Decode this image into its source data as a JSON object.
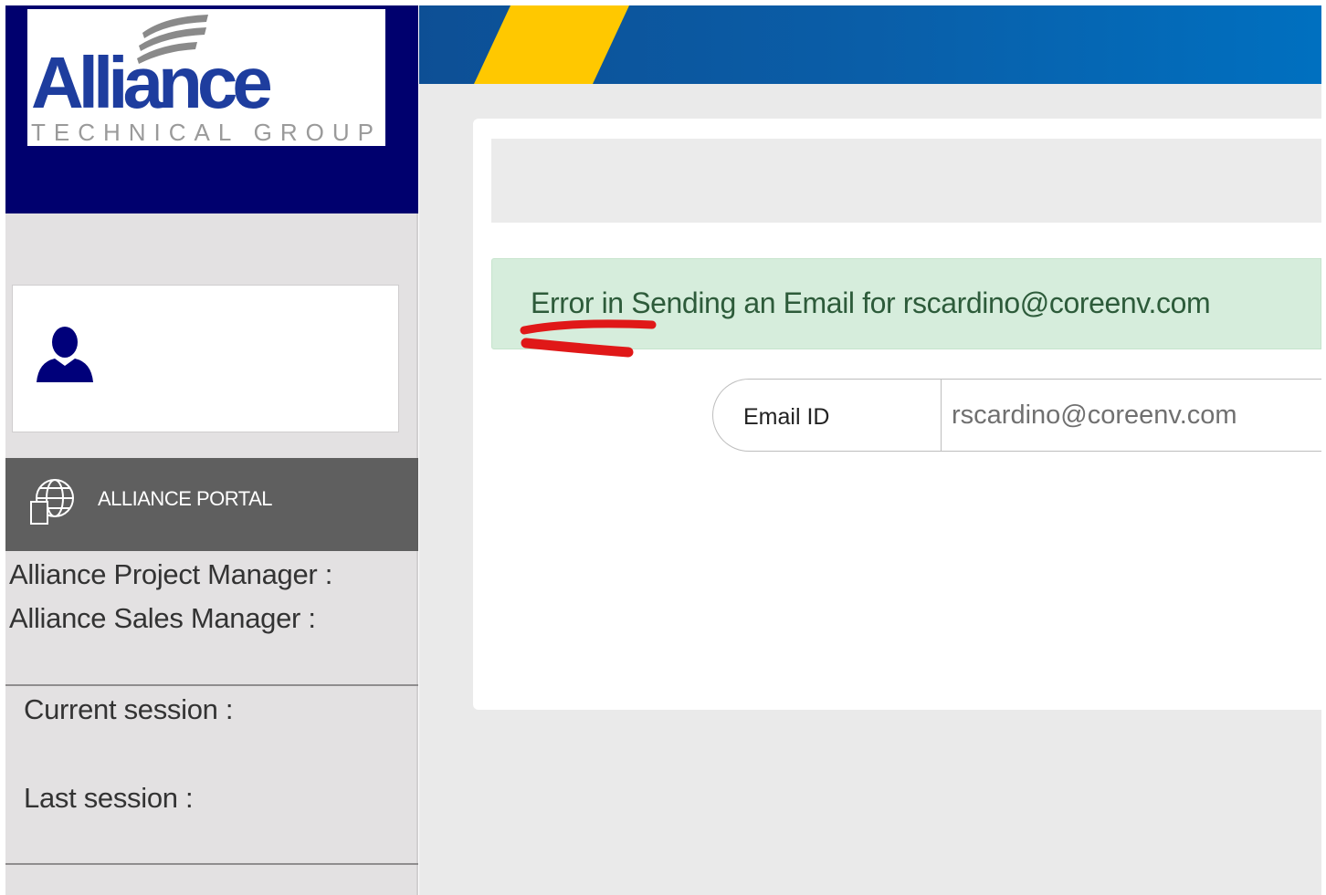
{
  "brand": {
    "logo_name": "Alliance",
    "logo_tagline": "TECHNICAL GROUP",
    "navy": "#00006e",
    "accent_yellow": "#ffc800",
    "header_blue": "#0a5ea8"
  },
  "sidebar": {
    "profile_icon": "user-icon",
    "portal_icon": "globe-icon",
    "portal_label": "ALLIANCE PORTAL",
    "project_manager_label": "Alliance Project Manager :",
    "sales_manager_label": "Alliance Sales Manager :",
    "current_session_label": "Current session :",
    "last_session_label": "Last session :"
  },
  "main": {
    "alert": {
      "text": "Error in Sending an Email for rscardino@coreenv.com",
      "color": "#d6eddc"
    },
    "email_field": {
      "label": "Email ID",
      "value": "rscardino@coreenv.com"
    }
  }
}
